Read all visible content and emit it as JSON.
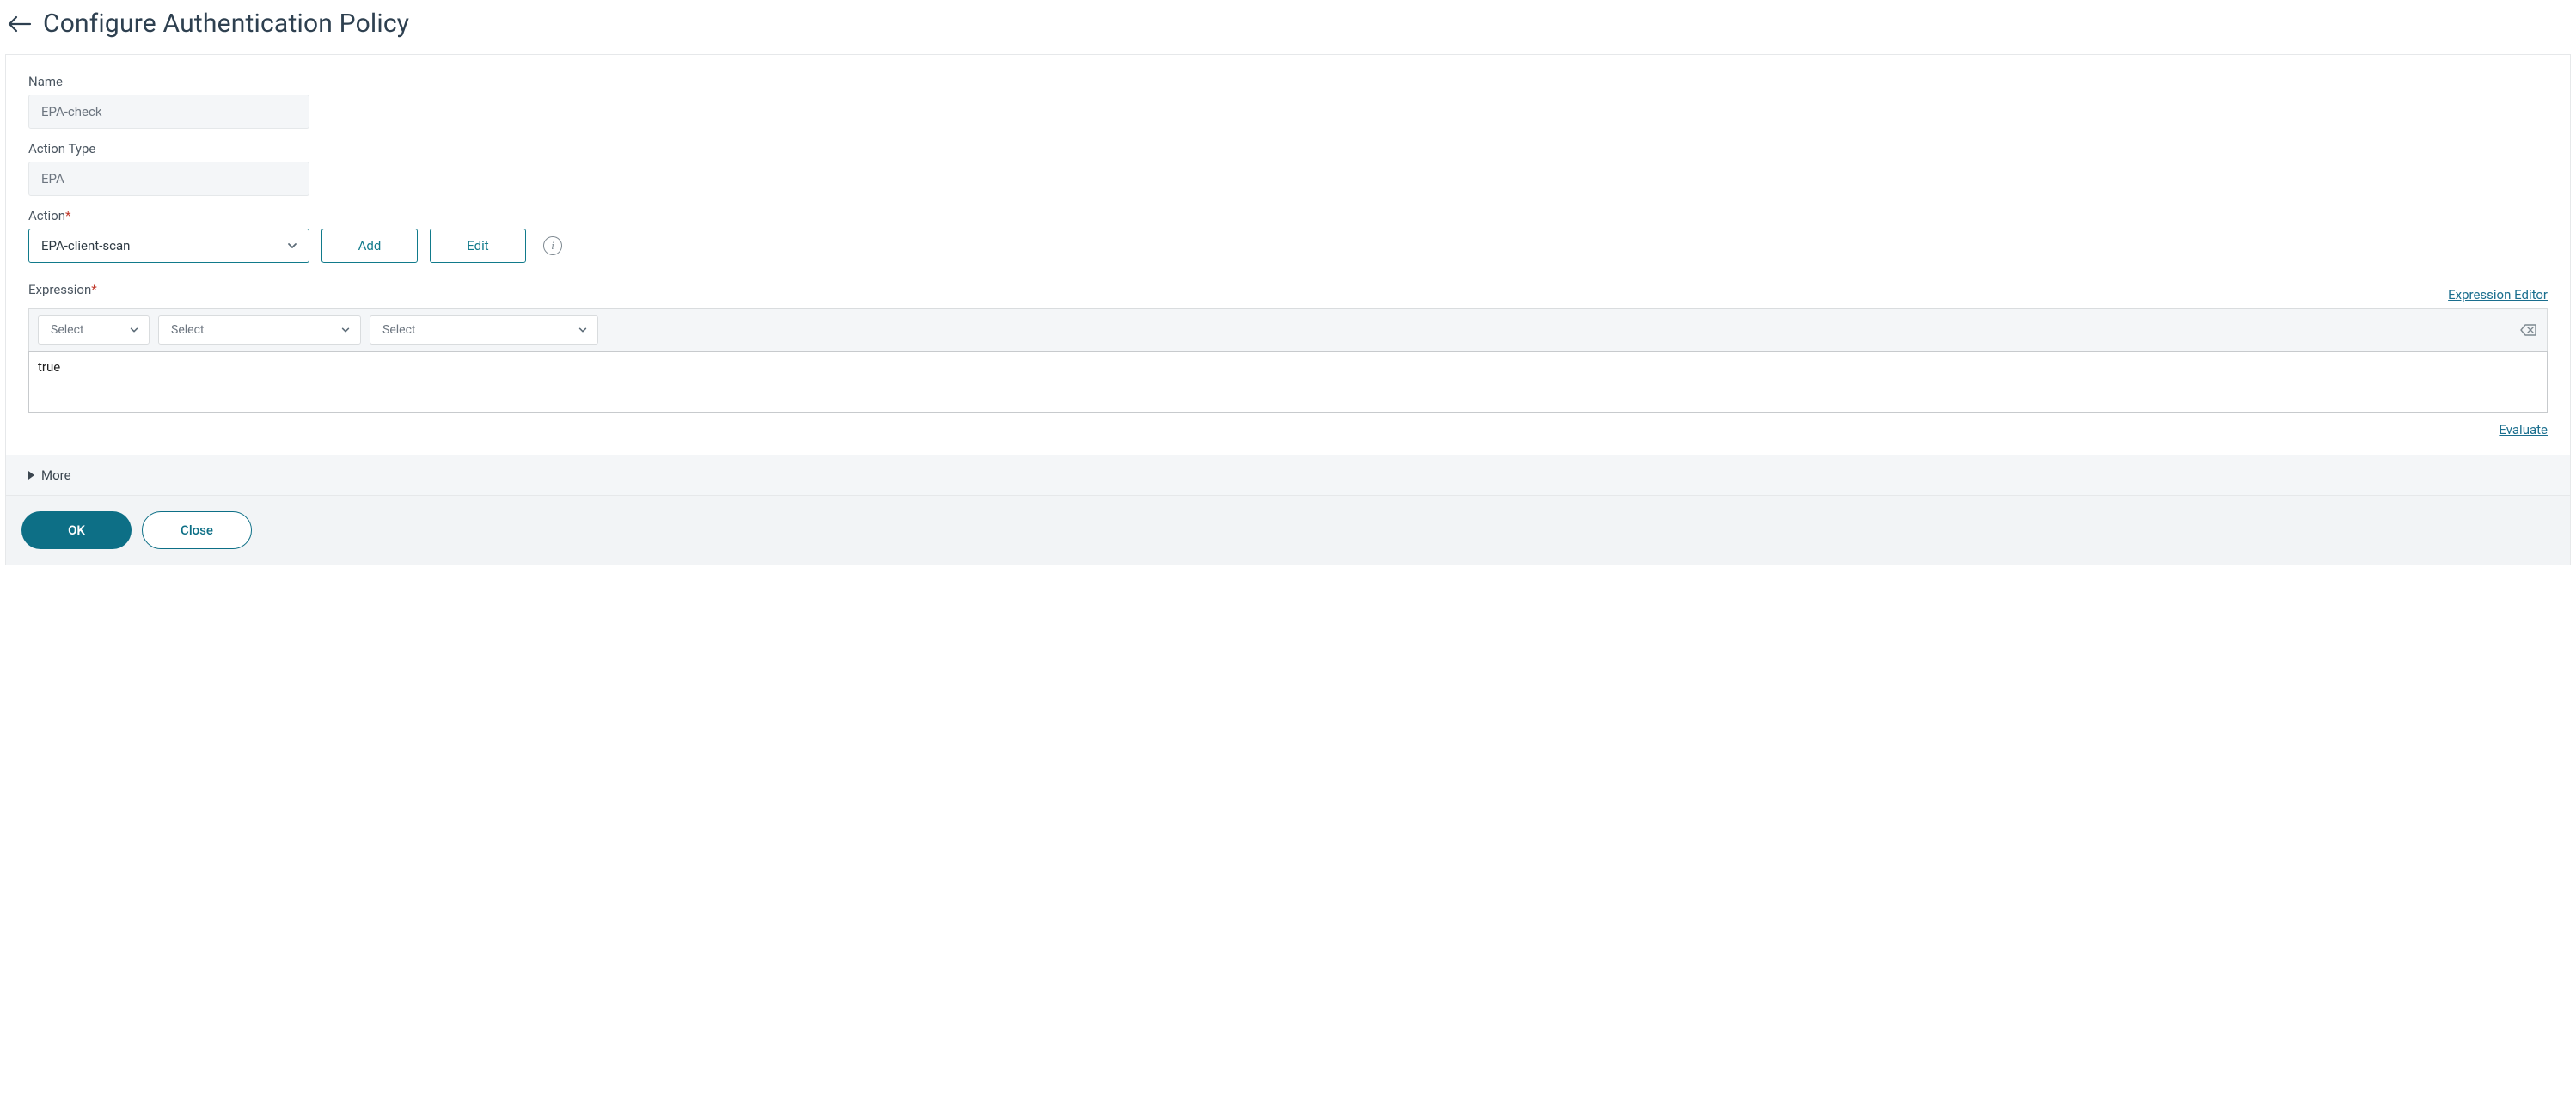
{
  "header": {
    "title": "Configure Authentication Policy"
  },
  "fields": {
    "name": {
      "label": "Name",
      "value": "EPA-check"
    },
    "action_type": {
      "label": "Action Type",
      "value": "EPA"
    },
    "action": {
      "label": "Action",
      "selected": "EPA-client-scan",
      "add_label": "Add",
      "edit_label": "Edit"
    },
    "expression": {
      "label": "Expression",
      "editor_link": "Expression Editor",
      "select1": "Select",
      "select2": "Select",
      "select3": "Select",
      "value": "true",
      "evaluate_link": "Evaluate"
    },
    "more_label": "More"
  },
  "footer": {
    "ok": "OK",
    "close": "Close"
  },
  "colors": {
    "accent": "#0d6f86",
    "border_accent": "#117a8b",
    "text_muted": "#6d7680",
    "panel_bg": "#f4f6f8"
  }
}
